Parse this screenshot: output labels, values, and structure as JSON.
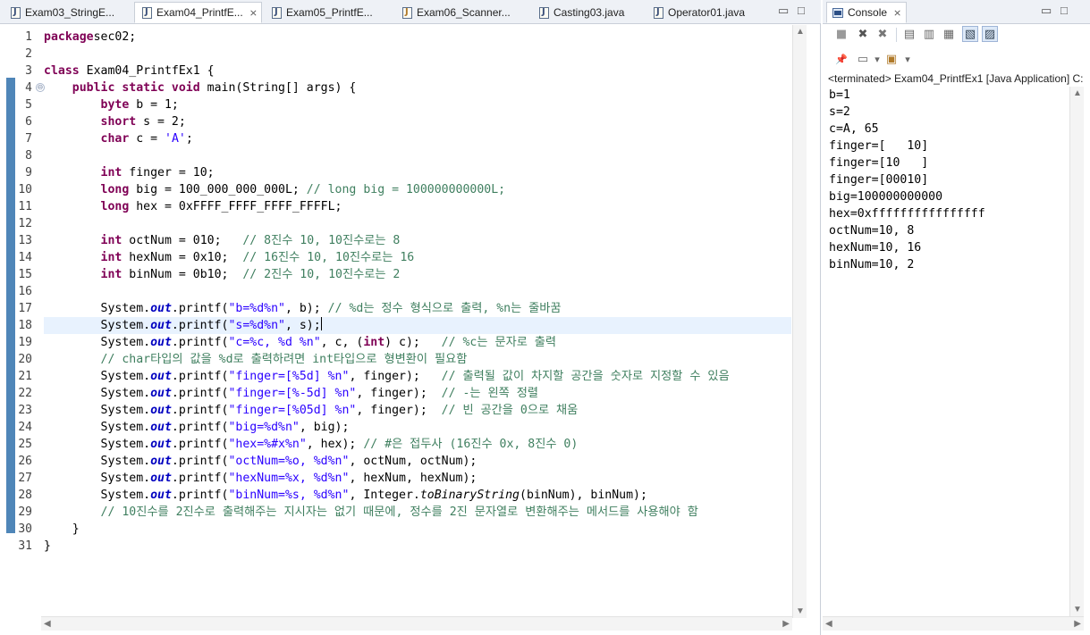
{
  "editor": {
    "tabs": [
      {
        "label": "Exam03_StringE...",
        "icon": "java-file-icon",
        "active": false
      },
      {
        "label": "Exam04_PrintfE...",
        "icon": "java-file-icon",
        "active": true,
        "close": "⨯"
      },
      {
        "label": "Exam05_PrintfE...",
        "icon": "java-file-icon",
        "active": false
      },
      {
        "label": "Exam06_Scanner...",
        "icon": "java-file-icon",
        "active": false
      },
      {
        "label": "Casting03.java",
        "icon": "java-file-icon",
        "active": false
      },
      {
        "label": "Operator01.java",
        "icon": "java-file-icon",
        "active": false
      }
    ],
    "minimize_glyph": "▭",
    "maximize_glyph": "□",
    "current_line": 18,
    "line_numbers": [
      "1",
      "2",
      "3",
      "4",
      "5",
      "6",
      "7",
      "8",
      "9",
      "10",
      "11",
      "12",
      "13",
      "14",
      "15",
      "16",
      "17",
      "18",
      "19",
      "20",
      "21",
      "22",
      "23",
      "24",
      "25",
      "26",
      "27",
      "28",
      "29",
      "30",
      "31"
    ],
    "fold_glyph": "⊖",
    "scroll_up": "▲",
    "scroll_down": "▼",
    "scroll_left": "◀",
    "scroll_right": "▶",
    "code": [
      [
        [
          "kw",
          "package"
        ],
        [
          "",
          "sec02;"
        ]
      ],
      [],
      [
        [
          "kw",
          "class"
        ],
        [
          "",
          " Exam04_PrintfEx1 {"
        ]
      ],
      [
        [
          "",
          "    "
        ],
        [
          "kw",
          "public static void"
        ],
        [
          "",
          " main(String[] args) {"
        ]
      ],
      [
        [
          "",
          "        "
        ],
        [
          "kw",
          "byte"
        ],
        [
          "",
          " b = 1;"
        ]
      ],
      [
        [
          "",
          "        "
        ],
        [
          "kw",
          "short"
        ],
        [
          "",
          " s = 2;"
        ]
      ],
      [
        [
          "",
          "        "
        ],
        [
          "kw",
          "char"
        ],
        [
          "",
          " c = "
        ],
        [
          "str",
          "'A'"
        ],
        [
          "",
          ";"
        ]
      ],
      [],
      [
        [
          "",
          "        "
        ],
        [
          "kw",
          "int"
        ],
        [
          "",
          " finger = 10;"
        ]
      ],
      [
        [
          "",
          "        "
        ],
        [
          "kw",
          "long"
        ],
        [
          "",
          " big = 100_000_000_000L; "
        ],
        [
          "cm",
          "// long big = 100000000000L;"
        ]
      ],
      [
        [
          "",
          "        "
        ],
        [
          "kw",
          "long"
        ],
        [
          "",
          " hex = 0xFFFF_FFFF_FFFF_FFFFL;"
        ]
      ],
      [],
      [
        [
          "",
          "        "
        ],
        [
          "kw",
          "int"
        ],
        [
          "",
          " octNum = 010;   "
        ],
        [
          "cm",
          "// 8진수 10, 10진수로는 8"
        ]
      ],
      [
        [
          "",
          "        "
        ],
        [
          "kw",
          "int"
        ],
        [
          "",
          " hexNum = 0x10;  "
        ],
        [
          "cm",
          "// 16진수 10, 10진수로는 16"
        ]
      ],
      [
        [
          "",
          "        "
        ],
        [
          "kw",
          "int"
        ],
        [
          "",
          " binNum = 0b10;  "
        ],
        [
          "cm",
          "// 2진수 10, 10진수로는 2"
        ]
      ],
      [],
      [
        [
          "",
          "        System."
        ],
        [
          "fld",
          "out"
        ],
        [
          "",
          ".printf("
        ],
        [
          "str",
          "\"b=%d%n\""
        ],
        [
          "",
          ", b); "
        ],
        [
          "cm",
          "// %d는 정수 형식으로 출력, %n는 줄바꿈"
        ]
      ],
      [
        [
          "",
          "        System."
        ],
        [
          "fld",
          "out"
        ],
        [
          "",
          ".printf("
        ],
        [
          "str",
          "\"s=%d%n\""
        ],
        [
          "",
          ", s);"
        ],
        [
          "caret",
          ""
        ]
      ],
      [
        [
          "",
          "        System."
        ],
        [
          "fld",
          "out"
        ],
        [
          "",
          ".printf("
        ],
        [
          "str",
          "\"c=%c, %d %n\""
        ],
        [
          "",
          ", c, ("
        ],
        [
          "kw",
          "int"
        ],
        [
          "",
          ") c);   "
        ],
        [
          "cm",
          "// %c는 문자로 출력"
        ]
      ],
      [
        [
          "",
          "        "
        ],
        [
          "cm",
          "// char타입의 값을 %d로 출력하려면 int타입으로 형변환이 필요함"
        ]
      ],
      [
        [
          "",
          "        System."
        ],
        [
          "fld",
          "out"
        ],
        [
          "",
          ".printf("
        ],
        [
          "str",
          "\"finger=[%5d] %n\""
        ],
        [
          "",
          ", finger);   "
        ],
        [
          "cm",
          "// 출력될 값이 차지할 공간을 숫자로 지정할 수 있음"
        ]
      ],
      [
        [
          "",
          "        System."
        ],
        [
          "fld",
          "out"
        ],
        [
          "",
          ".printf("
        ],
        [
          "str",
          "\"finger=[%-5d] %n\""
        ],
        [
          "",
          ", finger);  "
        ],
        [
          "cm",
          "// -는 왼쪽 정렬"
        ]
      ],
      [
        [
          "",
          "        System."
        ],
        [
          "fld",
          "out"
        ],
        [
          "",
          ".printf("
        ],
        [
          "str",
          "\"finger=[%05d] %n\""
        ],
        [
          "",
          ", finger);  "
        ],
        [
          "cm",
          "// 빈 공간을 0으로 채움"
        ]
      ],
      [
        [
          "",
          "        System."
        ],
        [
          "fld",
          "out"
        ],
        [
          "",
          ".printf("
        ],
        [
          "str",
          "\"big=%d%n\""
        ],
        [
          "",
          ", big);"
        ]
      ],
      [
        [
          "",
          "        System."
        ],
        [
          "fld",
          "out"
        ],
        [
          "",
          ".printf("
        ],
        [
          "str",
          "\"hex=%#x%n\""
        ],
        [
          "",
          ", hex); "
        ],
        [
          "cm",
          "// #은 접두사 (16진수 0x, 8진수 0)"
        ]
      ],
      [
        [
          "",
          "        System."
        ],
        [
          "fld",
          "out"
        ],
        [
          "",
          ".printf("
        ],
        [
          "str",
          "\"octNum=%o, %d%n\""
        ],
        [
          "",
          ", octNum, octNum);"
        ]
      ],
      [
        [
          "",
          "        System."
        ],
        [
          "fld",
          "out"
        ],
        [
          "",
          ".printf("
        ],
        [
          "str",
          "\"hexNum=%x, %d%n\""
        ],
        [
          "",
          ", hexNum, hexNum);"
        ]
      ],
      [
        [
          "",
          "        System."
        ],
        [
          "fld",
          "out"
        ],
        [
          "",
          ".printf("
        ],
        [
          "str",
          "\"binNum=%s, %d%n\""
        ],
        [
          "",
          ", Integer."
        ],
        [
          "mth",
          "toBinaryString"
        ],
        [
          "",
          "(binNum), binNum);"
        ]
      ],
      [
        [
          "",
          "        "
        ],
        [
          "cm",
          "// 10진수를 2진수로 출력해주는 지시자는 없기 때문에, 정수를 2진 문자열로 변환해주는 메서드를 사용해야 함"
        ]
      ],
      [
        [
          "",
          "    }"
        ]
      ],
      [
        [
          "",
          "}"
        ]
      ]
    ]
  },
  "console": {
    "tab_label": "Console",
    "close_glyph": "⨯",
    "toolbar_icons": [
      {
        "name": "terminate-icon",
        "glyph": "■"
      },
      {
        "name": "remove-launch-icon",
        "glyph": "✖"
      },
      {
        "name": "remove-all-launches-icon",
        "glyph": "✖"
      },
      {
        "name": "clear-console-icon",
        "glyph": "▤"
      },
      {
        "name": "scroll-lock-icon",
        "glyph": "▥"
      },
      {
        "name": "word-wrap-icon",
        "glyph": "▦"
      },
      {
        "name": "show-on-stdout-icon",
        "glyph": "▧"
      },
      {
        "name": "show-on-stderr-icon",
        "glyph": "▨"
      },
      {
        "name": "pin-console-icon",
        "glyph": "📌"
      },
      {
        "name": "display-selected-console-icon",
        "glyph": "▭"
      },
      {
        "name": "open-console-icon",
        "glyph": "▣"
      }
    ],
    "dropdown_glyph": "▾",
    "status": "<terminated> Exam04_PrintfEx1 [Java Application] C:",
    "output": [
      "b=1",
      "s=2",
      "c=A, 65",
      "finger=[   10]",
      "finger=[10   ]",
      "finger=[00010]",
      "big=100000000000",
      "hex=0xffffffffffffffff",
      "octNum=10, 8",
      "hexNum=10, 16",
      "binNum=10, 2"
    ]
  }
}
